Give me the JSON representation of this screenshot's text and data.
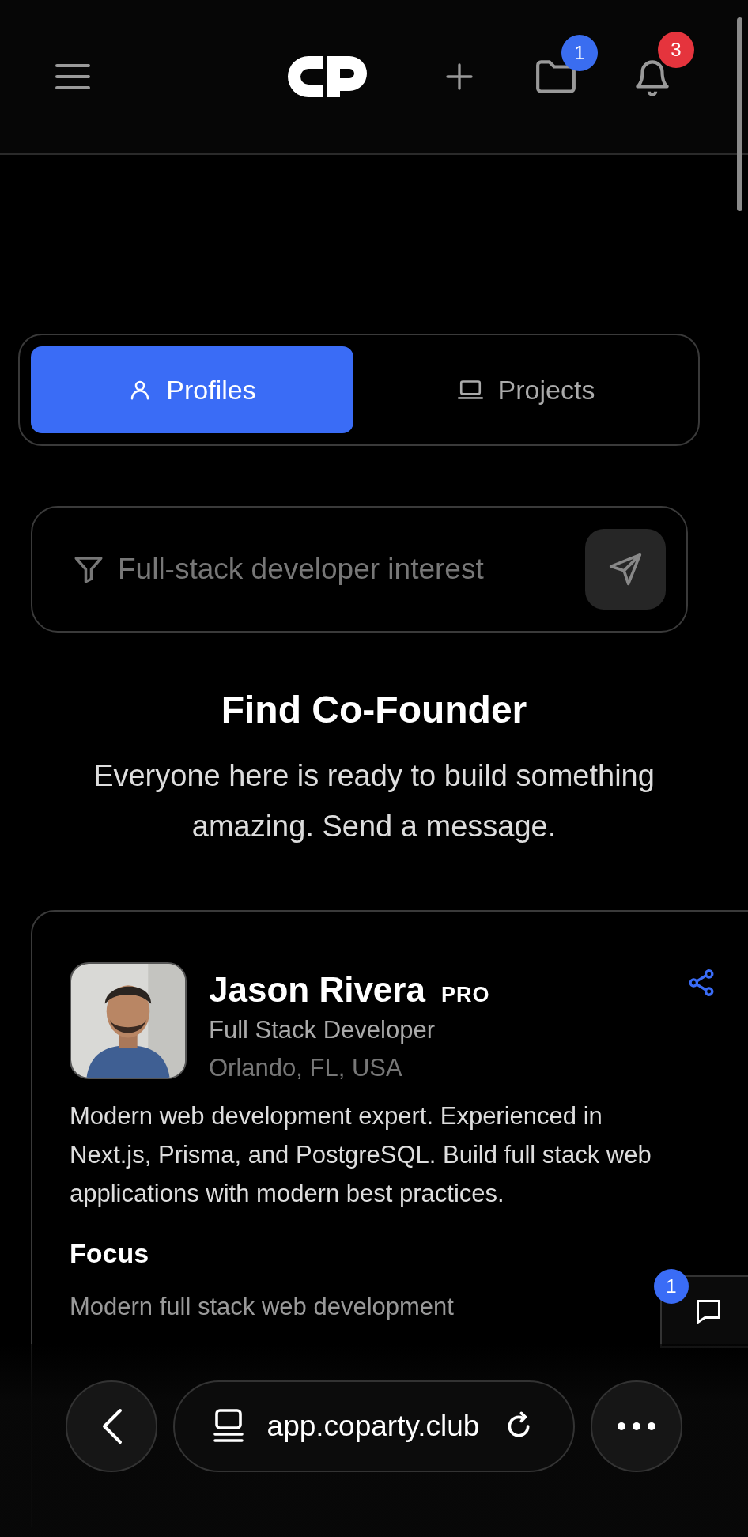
{
  "header": {
    "actions": [
      {
        "kind": "add"
      },
      {
        "kind": "folder",
        "badge": "1",
        "color": "#3a6df0"
      },
      {
        "kind": "bell",
        "badge": "3",
        "color": "#e5343d"
      }
    ]
  },
  "tabs": [
    {
      "label": "Profiles",
      "kind": "person",
      "selected": true
    },
    {
      "label": "Projects",
      "kind": "laptop",
      "selected": false
    }
  ],
  "search": {
    "placeholder": "Full-stack developer interest"
  },
  "hero": {
    "title": "Find Co-Founder",
    "subtitle": "Everyone here is ready to build something amazing. Send a message."
  },
  "profile": {
    "name": "Jason Rivera",
    "badge": "PRO",
    "role": "Full Stack Developer",
    "location": "Orlando, FL, USA",
    "bio": "Modern web development expert. Experienced in Next.js, Prisma, and PostgreSQL. Build full stack web applications with modern best practices.",
    "focus_heading": "Focus",
    "focus": "Modern full stack web development"
  },
  "chat": {
    "badge": "1"
  },
  "browser": {
    "url": "app.coparty.club"
  }
}
